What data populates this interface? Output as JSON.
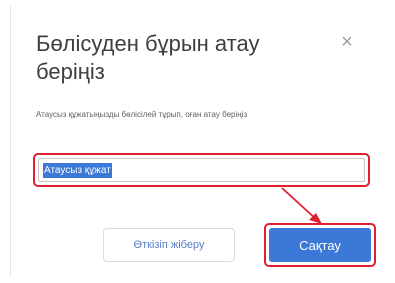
{
  "dialog": {
    "title": "Бөлісуден бұрын атау беріңіз",
    "close_glyph": "×",
    "description": "Атаусыз құжатыңызды бөлісілей тұрып, оған атау беріңіз",
    "input_value": "Атаусыз құжат",
    "skip_label": "Өткізіп жіберу",
    "save_label": "Сақтау"
  },
  "colors": {
    "accent": "#3b78d8",
    "highlight_outline": "#e0202f",
    "link_text": "#5a7ec9"
  },
  "icons": {
    "close": "close-icon",
    "annotation": "arrow-annotation"
  }
}
